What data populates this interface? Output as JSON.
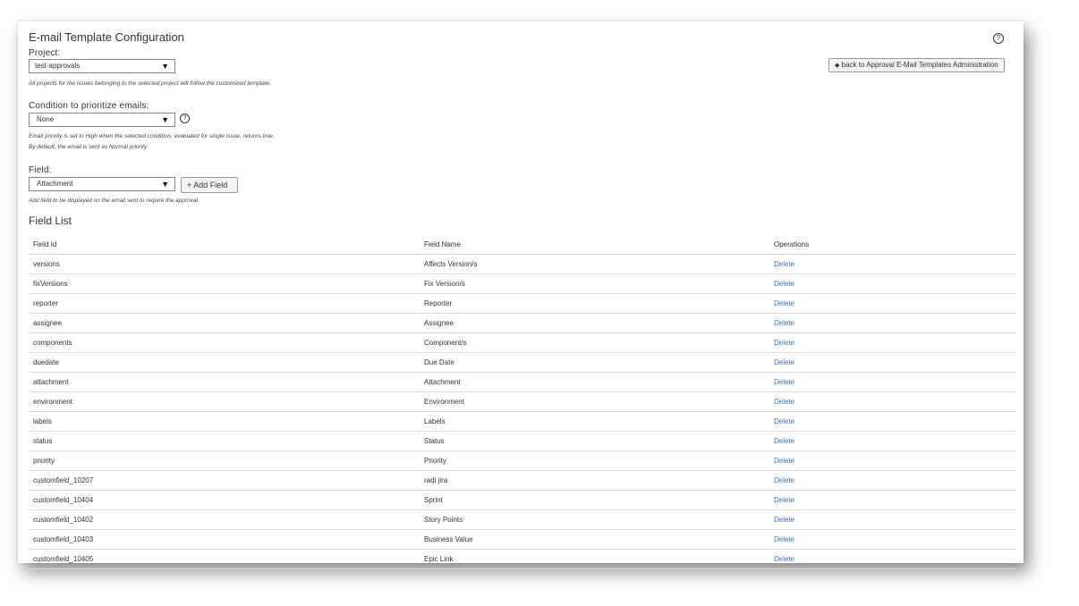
{
  "page": {
    "title": "E-mail Template Configuration",
    "help_glyph": "?",
    "back_button": "back to Approval E-Mail Templates Administration",
    "back_icon": "◆"
  },
  "project": {
    "label": "Project:",
    "value": "test-approvals",
    "hint": "All projects for the issues belonging to the selected project will follow the customized template."
  },
  "condition": {
    "label": "Condition to prioritize emails:",
    "value": "None",
    "hint_line1": "Email priority is set to High when the selected condition, evaluated for single issue, returns true.",
    "hint_line2": "By default, the email is sent as Normal priority"
  },
  "field": {
    "label": "Field:",
    "value": "Attachment",
    "add_button": "+ Add Field",
    "hint": "Add field to be displayed on the email sent to require the approval."
  },
  "dropdown_arrow": "▼",
  "field_list": {
    "title": "Field List",
    "headers": [
      "Field Id",
      "Field Name",
      "Operations"
    ],
    "rows": [
      {
        "id": "versions",
        "name": "Affects Version/s",
        "op": "Delete"
      },
      {
        "id": "fixVersions",
        "name": "Fix Version/s",
        "op": "Delete"
      },
      {
        "id": "reporter",
        "name": "Reporter",
        "op": "Delete"
      },
      {
        "id": "assignee",
        "name": "Assignee",
        "op": "Delete"
      },
      {
        "id": "components",
        "name": "Component/s",
        "op": "Delete"
      },
      {
        "id": "duedate",
        "name": "Due Date",
        "op": "Delete"
      },
      {
        "id": "attachment",
        "name": "Attachment",
        "op": "Delete"
      },
      {
        "id": "environment",
        "name": "Environment",
        "op": "Delete"
      },
      {
        "id": "labels",
        "name": "Labels",
        "op": "Delete"
      },
      {
        "id": "status",
        "name": "Status",
        "op": "Delete"
      },
      {
        "id": "priority",
        "name": "Priority",
        "op": "Delete"
      },
      {
        "id": "customfield_10207",
        "name": "radi jira",
        "op": "Delete"
      },
      {
        "id": "customfield_10404",
        "name": "Sprint",
        "op": "Delete"
      },
      {
        "id": "customfield_10402",
        "name": "Story Points",
        "op": "Delete"
      },
      {
        "id": "customfield_10403",
        "name": "Business Value",
        "op": "Delete"
      },
      {
        "id": "customfield_10405",
        "name": "Epic Link",
        "op": "Delete"
      }
    ]
  },
  "colors": {
    "link": "#3b73af",
    "border": "#dddddd"
  }
}
